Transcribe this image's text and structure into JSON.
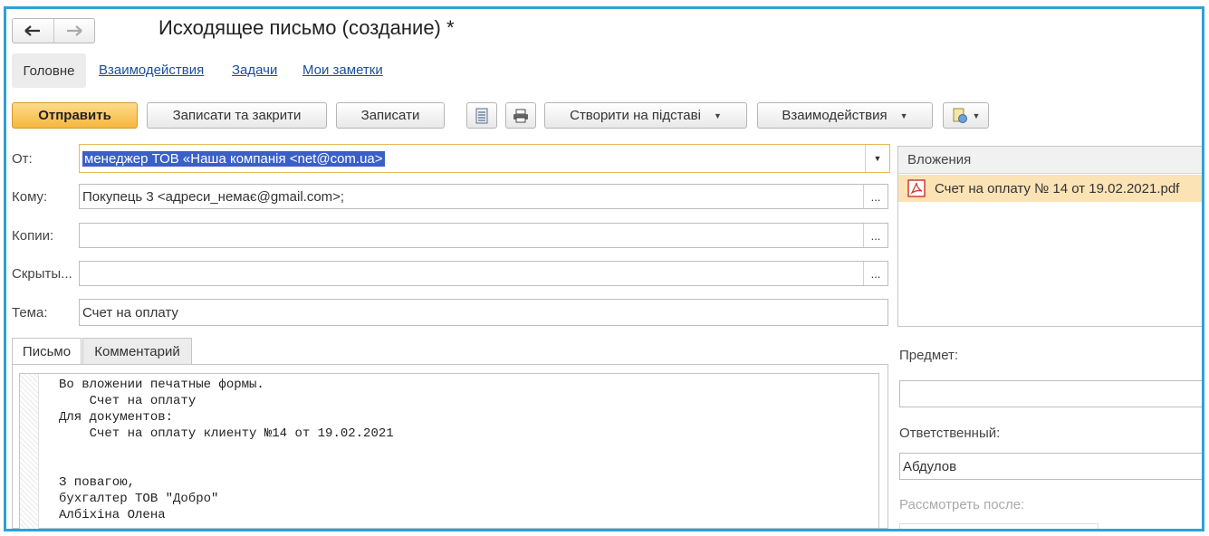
{
  "window": {
    "title": "Исходящее письмо (создание) *"
  },
  "nav": {
    "back_icon": "arrow-left-icon",
    "forward_icon": "arrow-right-icon"
  },
  "sections": [
    {
      "label": "Головне",
      "active": true
    },
    {
      "label": "Взаимодействия",
      "active": false
    },
    {
      "label": "Задачи",
      "active": false
    },
    {
      "label": "Мои заметки",
      "active": false
    }
  ],
  "toolbar": {
    "send_label": "Отправить",
    "save_close_label": "Записати та закрити",
    "save_label": "Записати",
    "create_based_label": "Створити на підставі",
    "interactions_label": "Взаимодействия",
    "doc_icon": "document-list-icon",
    "print_icon": "printer-icon",
    "more_icon": "document-settings-icon"
  },
  "form": {
    "from_label": "От:",
    "from_value": "менеджер ТОВ «Наша компанія <net@com.ua>",
    "to_label": "Кому:",
    "to_value": "Покупець 3 <адреси_немає@gmail.com>;",
    "cc_label": "Копии:",
    "cc_value": "",
    "bcc_label": "Скрыты...",
    "bcc_value": "",
    "subject_label": "Тема:",
    "subject_value": "Счет на оплату",
    "choose_btn": "..."
  },
  "body_tabs": [
    {
      "label": "Письмо",
      "active": true
    },
    {
      "label": "Комментарий",
      "active": false
    }
  ],
  "body_text": "Во вложении печатные формы.\n    Счет на оплату\nДля документов:\n    Счет на оплату клиенту №14 от 19.02.2021\n\n\nЗ повагою,\nбухгалтер ТОВ \"Добро\"\nАлбіхіна Олена",
  "attachments": {
    "header": "Вложения",
    "items": [
      {
        "name": "Счет на оплату № 14 от 19.02.2021.pdf",
        "icon": "pdf-file-icon"
      }
    ]
  },
  "right_panel": {
    "subject_label": "Предмет:",
    "subject_value": "",
    "responsible_label": "Ответственный:",
    "responsible_value": "Абдулов",
    "review_after_label": "Рассмотреть после:"
  },
  "colors": {
    "accent": "#2ea1d9",
    "primary_button": "#f6b73e",
    "selection": "#3b5fc9",
    "attachment_selected": "#fbe3b6",
    "link": "#1a4e9c"
  }
}
